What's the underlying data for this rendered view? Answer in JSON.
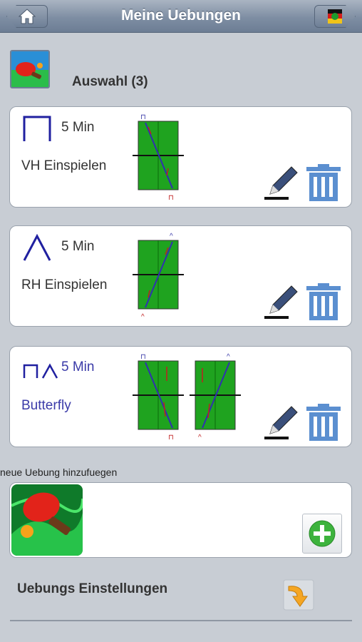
{
  "header": {
    "title": "Meine Uebungen",
    "home_icon": "home-icon",
    "forward_icon": "germany-flag-icon"
  },
  "selection": {
    "label": "Auswahl (3)",
    "icon": "table-tennis-icon"
  },
  "exercises": [
    {
      "symbol": "⊓",
      "duration": "5 Min",
      "name": "VH Einspielen",
      "color": "#333333"
    },
    {
      "symbol": "∧",
      "duration": "5 Min",
      "name": "RH Einspielen",
      "color": "#333333"
    },
    {
      "symbol": "⊓∧",
      "duration": "5 Min",
      "name": "Butterfly",
      "color": "#3a3aa8"
    }
  ],
  "diagram_labels": {
    "ex1": {
      "top": "⊓",
      "bottom": "⊓"
    },
    "ex2": {
      "top": "^",
      "bottom": "^"
    },
    "ex3a": {
      "top": "⊓",
      "bottom": "⊓"
    },
    "ex3b": {
      "top": "^",
      "bottom": "^"
    }
  },
  "add": {
    "label": "neue Uebung hinzufuegen",
    "icon": "add-icon"
  },
  "settings": {
    "label": "Uebungs Einstellungen",
    "icon": "arrow-icon"
  },
  "colors": {
    "accent": "#3a3aa8",
    "table_green": "#1fa31f",
    "bar": "#7e8ea3"
  }
}
